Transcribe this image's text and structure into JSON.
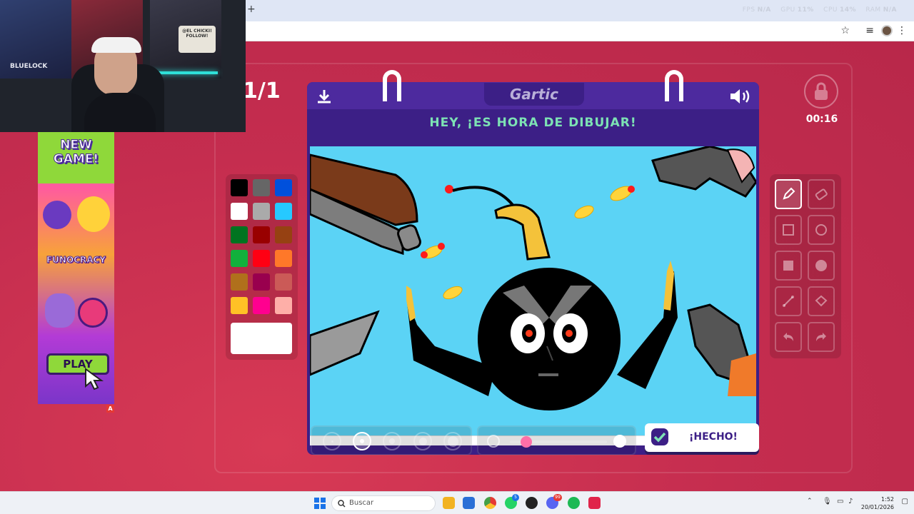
{
  "browser": {
    "new_tab": "+",
    "perf": [
      {
        "label": "FPS",
        "value": "N/A"
      },
      {
        "label": "GPU",
        "value": "11%"
      },
      {
        "label": "CPU",
        "value": "14%"
      },
      {
        "label": "RAM",
        "value": "N/A"
      }
    ]
  },
  "game": {
    "round": "1/1",
    "timer": "00:16",
    "logo": "Gartic",
    "headline": "HEY, ¡ES HORA DE DIBUJAR!",
    "done_label": "¡HECHO!",
    "palette": [
      "#000000",
      "#666666",
      "#0050dc",
      "#ffffff",
      "#aaaaaa",
      "#26c9ff",
      "#017420",
      "#990000",
      "#964112",
      "#11b03c",
      "#ff0013",
      "#ff7829",
      "#b0701c",
      "#99004e",
      "#cb5a57",
      "#ffc126",
      "#ff008f",
      "#feafa8"
    ],
    "current_color": "#ffffff",
    "tools": [
      "pencil",
      "eraser",
      "rectangle-outline",
      "ellipse-outline",
      "rectangle-fill",
      "ellipse-fill",
      "line",
      "fill-bucket",
      "undo",
      "redo"
    ],
    "active_tool": "pencil",
    "brush_sizes": 5,
    "selected_size_index": 1,
    "opacity_level": 0.05
  },
  "ad": {
    "headline": "NEW GAME!",
    "brand": "FUNOCRACY",
    "play_label": "PLAY",
    "badge": "A"
  },
  "webcam": {
    "poster_text": "BLUELOCK",
    "sign_text": "@EL CHICKI! FOLLOW!"
  },
  "taskbar": {
    "search_placeholder": "Buscar",
    "time": "1:52",
    "date": "20/01/2026",
    "app_badge": "5",
    "discord_badge": "99"
  },
  "colors": {
    "page_bg": "#c32a4c",
    "card_bg": "#3c1f86",
    "headline": "#7de2b4",
    "canvas_bg": "#5bd3f5"
  }
}
